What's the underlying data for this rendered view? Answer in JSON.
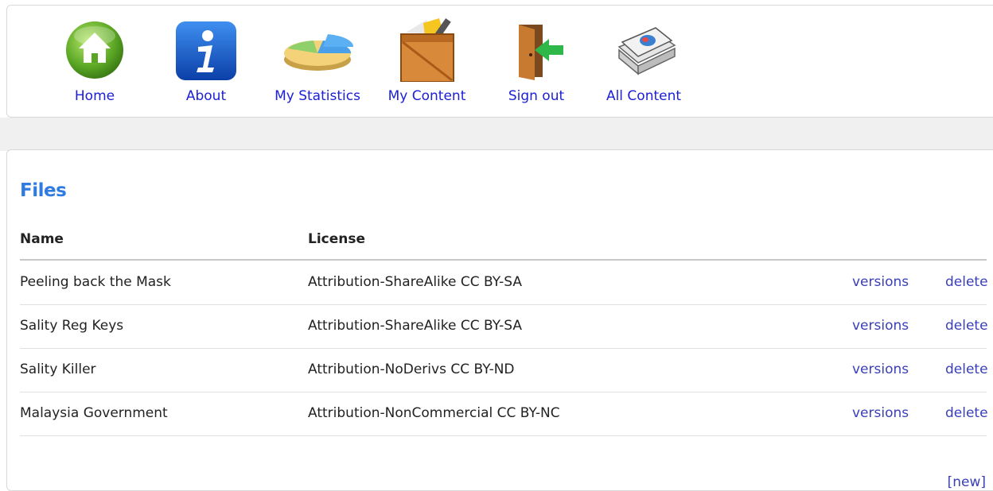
{
  "nav": {
    "items": [
      {
        "label": "Home",
        "icon": "home-icon"
      },
      {
        "label": "About",
        "icon": "info-icon"
      },
      {
        "label": "My Statistics",
        "icon": "pie-chart-icon"
      },
      {
        "label": "My Content",
        "icon": "content-box-icon"
      },
      {
        "label": "Sign out",
        "icon": "sign-out-door-icon"
      },
      {
        "label": "All Content",
        "icon": "document-stack-icon"
      }
    ]
  },
  "files": {
    "title": "Files",
    "columns": {
      "name": "Name",
      "license": "License"
    },
    "rows": [
      {
        "name": "Peeling back the Mask",
        "license": "Attribution-ShareAlike CC BY-SA",
        "versions": "versions",
        "delete": "delete"
      },
      {
        "name": "Sality Reg Keys",
        "license": "Attribution-ShareAlike CC BY-SA",
        "versions": "versions",
        "delete": "delete"
      },
      {
        "name": "Sality Killer",
        "license": "Attribution-NoDerivs CC BY-ND",
        "versions": "versions",
        "delete": "delete"
      },
      {
        "name": "Malaysia Government",
        "license": "Attribution-NonCommercial CC BY-NC",
        "versions": "versions",
        "delete": "delete"
      }
    ],
    "new_label": "[new]"
  },
  "colors": {
    "nav_link": "#1c20d6",
    "title": "#2f7be0",
    "action_link": "#3a3fb8"
  }
}
